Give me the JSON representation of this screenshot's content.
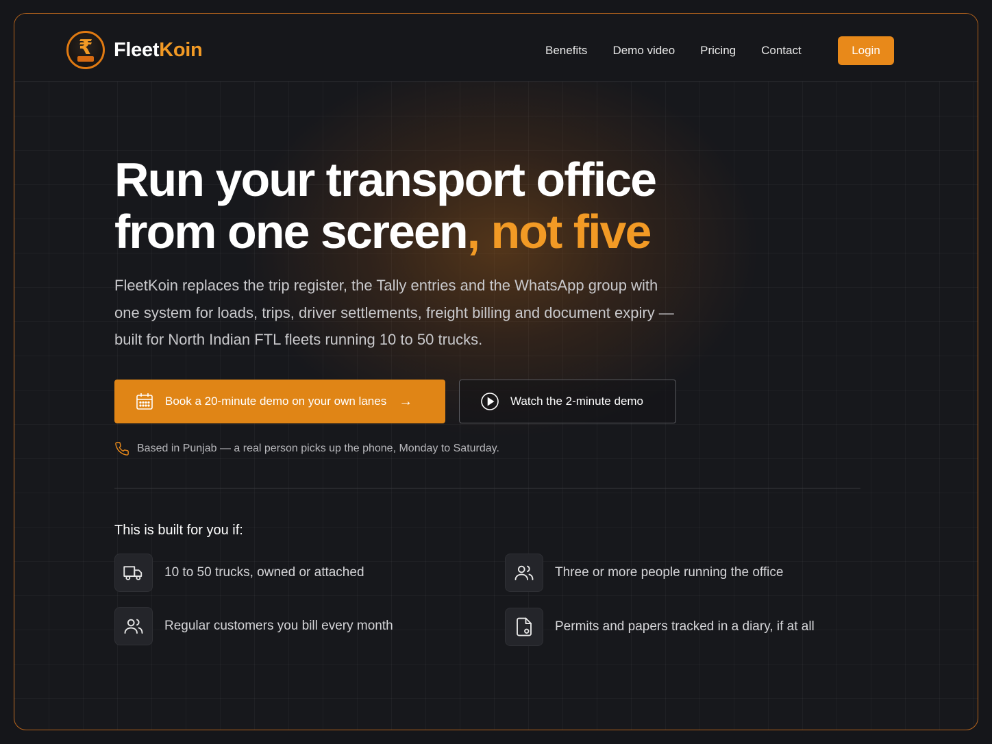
{
  "brand": {
    "name_part1": "Fleet",
    "name_part2": "Koin",
    "logo_symbol": "₹"
  },
  "nav": {
    "links": [
      "Benefits",
      "Demo video",
      "Pricing",
      "Contact"
    ],
    "login_label": "Login"
  },
  "hero": {
    "title_line1": "Run your transport office",
    "title_line2_main": "from one screen",
    "title_line2_accent": ", not five",
    "subtitle": "FleetKoin replaces the trip register, the Tally entries and the WhatsApp group with one system for loads, trips, driver settlements, freight billing and document expiry — built for North Indian FTL fleets running 10 to 50 trucks.",
    "cta_primary": "Book a 20-minute demo on your own lanes",
    "cta_secondary": "Watch the 2-minute demo",
    "phone_note": "Based in Punjab — a real person picks up the phone, Monday to Saturday."
  },
  "built_for": {
    "title": "This is built for you if:",
    "items": [
      {
        "icon": "truck-icon",
        "text": "10 to 50 trucks, owned or attached"
      },
      {
        "icon": "users-icon",
        "text": "Three or more people running the office"
      },
      {
        "icon": "customers-icon",
        "text": "Regular customers you bill every month"
      },
      {
        "icon": "document-icon",
        "text": "Permits and papers tracked in a diary, if at all"
      }
    ]
  },
  "colors": {
    "accent": "#e8891a",
    "accent_text": "#f29a25",
    "background": "#17181c"
  }
}
